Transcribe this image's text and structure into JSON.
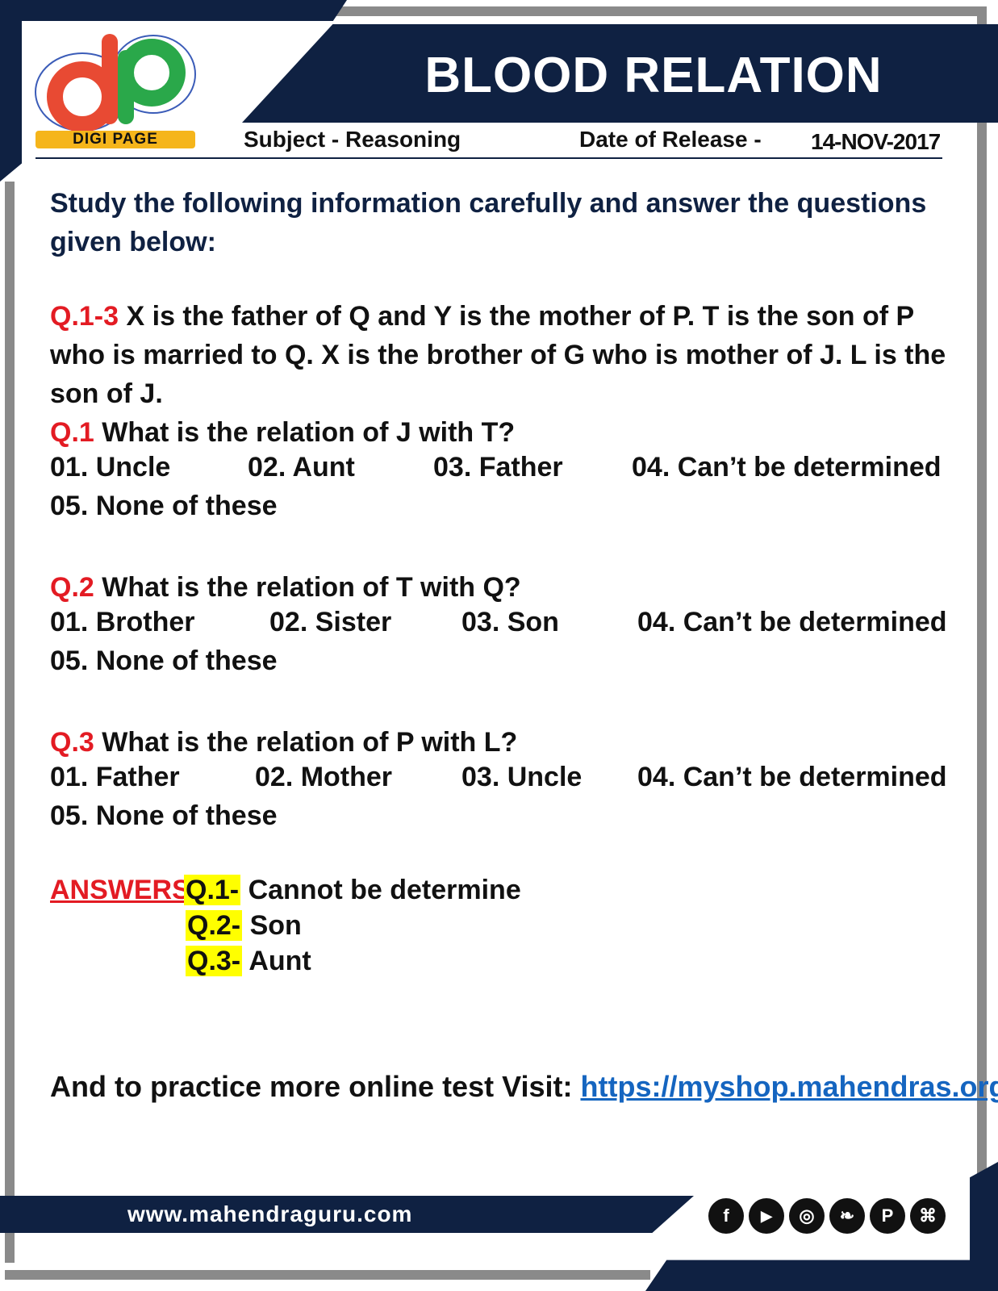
{
  "header": {
    "title": "BLOOD RELATION",
    "logo_text": "DIGI PAGE",
    "subject": "Subject - Reasoning",
    "date_label": "Date of Release -",
    "date": "14-NOV-2017"
  },
  "intro": "Study the following information carefully and answer the questions given below:",
  "passage": {
    "label": "Q.1-3",
    "text": "X is the father of Q and Y is the mother of P. T is the son of P who is married to Q. X is the brother of G who is mother of J. L is the son of J."
  },
  "questions": [
    {
      "label": "Q.1",
      "text": "What is the relation of J with T?",
      "options": [
        "01. Uncle",
        "02. Aunt",
        "03. Father",
        "04. Can’t be determined",
        "05. None of these"
      ]
    },
    {
      "label": "Q.2",
      "text": "What is the relation of T with Q?",
      "options": [
        "01. Brother",
        "02. Sister",
        "03. Son",
        "04. Can’t be determined",
        "05. None of these"
      ]
    },
    {
      "label": "Q.3",
      "text": "What is the relation of P with L?",
      "options": [
        "01. Father",
        "02. Mother",
        "03. Uncle",
        "04. Can’t be determined",
        "05. None of these"
      ]
    }
  ],
  "answers": {
    "label": "ANSWERS:",
    "items": [
      {
        "q": "Q.1-",
        "a": "Cannot be determine"
      },
      {
        "q": "Q.2-",
        "a": "Son"
      },
      {
        "q": "Q.3-",
        "a": "Aunt"
      }
    ]
  },
  "practice": {
    "text": "And to practice more online test Visit:",
    "link": "https://myshop.mahendras.org"
  },
  "footer": {
    "url": "www.mahendraguru.com",
    "social": [
      {
        "name": "facebook-icon",
        "glyph": "f"
      },
      {
        "name": "youtube-icon",
        "glyph": "▶"
      },
      {
        "name": "instagram-icon",
        "glyph": "◎"
      },
      {
        "name": "twitter-icon",
        "glyph": "❧"
      },
      {
        "name": "pinterest-icon",
        "glyph": "P"
      },
      {
        "name": "android-icon",
        "glyph": "⌘"
      }
    ]
  },
  "colors": {
    "navy": "#0f2142",
    "red": "#e31b23",
    "highlight": "#ffff00",
    "link": "#1565c0",
    "badge": "#f5b51b"
  }
}
